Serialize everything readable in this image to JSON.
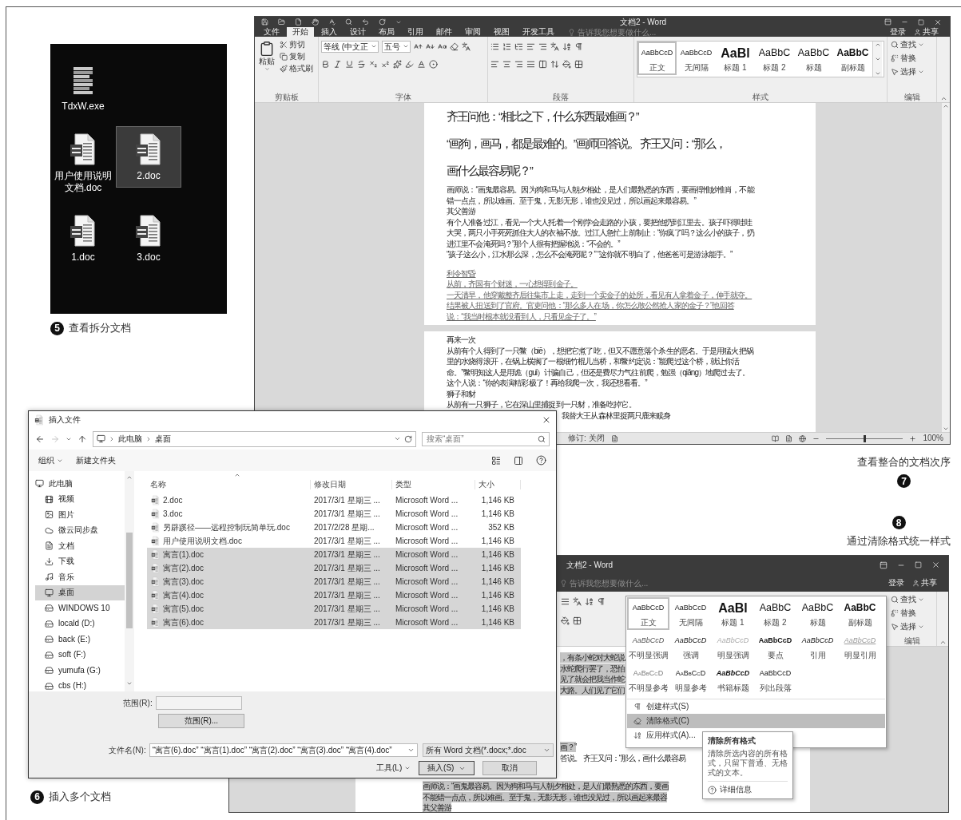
{
  "desktop": {
    "icons": [
      {
        "label": "TdxW.exe",
        "kind": "exe",
        "selected": false
      },
      {
        "label": "用户使用说明文档.doc",
        "kind": "doc",
        "selected": false
      },
      {
        "label": "2.doc",
        "kind": "doc",
        "selected": true
      },
      {
        "label": "1.doc",
        "kind": "doc",
        "selected": false
      },
      {
        "label": "3.doc",
        "kind": "doc",
        "selected": false
      }
    ]
  },
  "caption_5": {
    "number": "5",
    "text": "查看拆分文档"
  },
  "word_window": {
    "title": "文档2 - Word",
    "tabs": [
      {
        "label": "文件",
        "selected": false
      },
      {
        "label": "开始",
        "selected": true
      },
      {
        "label": "插入",
        "selected": false
      },
      {
        "label": "设计",
        "selected": false
      },
      {
        "label": "布局",
        "selected": false
      },
      {
        "label": "引用",
        "selected": false
      },
      {
        "label": "邮件",
        "selected": false
      },
      {
        "label": "审阅",
        "selected": false
      },
      {
        "label": "视图",
        "selected": false
      },
      {
        "label": "开发工具",
        "selected": false
      }
    ],
    "tell_me": {
      "placeholder": "告诉我您想要做什么..."
    },
    "sign_in": "登录",
    "share": "共享",
    "clipboard": {
      "label": "剪贴板",
      "paste": "粘贴",
      "cut": "剪切",
      "copy": "复制",
      "format_painter": "格式刷"
    },
    "font": {
      "label": "字体",
      "font_name": "等线 (中文正",
      "font_size": "五号"
    },
    "paragraph": {
      "label": "段落"
    },
    "styles": {
      "label": "样式",
      "items": [
        {
          "preview": "AaBbCcD",
          "name": "正文",
          "kind": "normal",
          "selected": true
        },
        {
          "preview": "AaBbCcD",
          "name": "无间隔",
          "kind": "nospacing",
          "selected": false
        },
        {
          "preview": "AaBl",
          "name": "标题 1",
          "kind": "heading1",
          "selected": false
        },
        {
          "preview": "AaBbC",
          "name": "标题 2",
          "kind": "heading2",
          "selected": false
        },
        {
          "preview": "AaBbC",
          "name": "标题",
          "kind": "title",
          "selected": false
        },
        {
          "preview": "AaBbC",
          "name": "副标题",
          "kind": "subtitle",
          "selected": false
        }
      ]
    },
    "editing": {
      "label": "编辑",
      "find": "查找",
      "replace": "替换",
      "select": "选择"
    },
    "page_1": [
      {
        "kind": "heading",
        "text": "齐王问他：“相比之下，什么东西最难画？”"
      },
      {
        "kind": "heading",
        "text": "“画狗，画马，都是最难的。”画师回答说。 齐王又问：“那么，"
      },
      {
        "kind": "heading",
        "text": "画什么最容易呢？”"
      },
      {
        "kind": "body",
        "text": "画师说：“画鬼最容易。因为狗和马与人朝夕相处，是人们最熟悉的东西，要画得惟妙惟肖，不能错一点点，所以难画。至于鬼，无影无形，谁也没见过，所以画起来最容易。”"
      },
      {
        "kind": "body",
        "text": "其父善游"
      },
      {
        "kind": "body",
        "text": "有个人准备过江，看见一个大人托着一个刚学会走路的小孩，要把他扔到江里去。孩子吓得哇哇大哭，两只小手死死抓住大人的衣袖不放。过江人急忙上前制止：“你疯了吗？这么小的孩子，扔进江里不会淹死吗？”那个人很有把握地说：“不会的。”"
      },
      {
        "kind": "body",
        "text": "“孩子这么小，江水那么深，怎么不会淹死呢？” “这你就不明白了，他爸爸可是游泳能手。”"
      },
      {
        "kind": "revised",
        "text": "利令智昏"
      },
      {
        "kind": "revised",
        "text": "从前，齐国有个财迷，一心想得到金子。"
      },
      {
        "kind": "revised",
        "text": "一天清早，他穿戴整齐后往集市上走，走到一个卖金子的处所，看见有人拿着金子，伸手就夺。结果被人扭送到了官府。官吏问他：“那么多人在场，你怎么敢公然抢人家的金子？”他回答说：“我当时根本就没看到人，只看见金子了。”"
      }
    ],
    "page_2": [
      {
        "kind": "body",
        "text": "再来一次"
      },
      {
        "kind": "body",
        "text": "从前有个人得到了一只鳖（biē），想把它煮了吃，但又不愿意落个杀生的恶名。于是用猛火把锅里的水烧得滚开，在锅上横搁了一根细竹棍儿当桥，和鳖约定说：“能爬过这个桥，就让你活命。”鳖明知这人是用诡（guǐ）计骗自己，但还是费尽力气往前爬，勉强（qiǎng）地爬过去了。这个人说：“你的表演精彩极了！再给我爬一次，我还想看看。”"
      },
      {
        "kind": "body",
        "text": "狮子和豺"
      },
      {
        "kind": "body",
        "text": "从前有一只狮子，它在深山里捕捉到一只豺，准备吃掉它。"
      },
      {
        "kind": "partial",
        "text": "我替大王从森林里捉两只鹿来赎身"
      }
    ],
    "status_bar": {
      "track_changes": "修订: 关闭",
      "zoom": {
        "level": 0.5,
        "reading": "100%"
      }
    }
  },
  "caption_7": {
    "number": "7",
    "text": "查看整合的文档次序"
  },
  "caption_8": {
    "number": "8",
    "text": "通过清除格式统一样式"
  },
  "word_window_2": {
    "title": "文档2 - Word",
    "tell_me": {
      "placeholder": "告诉我您想要做什么..."
    },
    "sign_in": "登录",
    "share": "共享",
    "editing": {
      "label": "编辑",
      "find": "查找",
      "replace": "替换",
      "select": "选择"
    },
    "style_gallery": {
      "items": [
        {
          "preview": "AaBbCcD",
          "name": "正文",
          "kind": "normal",
          "selected": true
        },
        {
          "preview": "AaBbCcD",
          "name": "无间隔",
          "kind": "nospacing",
          "selected": false
        },
        {
          "preview": "AaBl",
          "name": "标题 1",
          "kind": "heading1",
          "selected": false
        },
        {
          "preview": "AaBbC",
          "name": "标题 2",
          "kind": "heading2",
          "selected": false
        },
        {
          "preview": "AaBbC",
          "name": "标题",
          "kind": "title",
          "selected": false
        },
        {
          "preview": "AaBbC",
          "name": "副标题",
          "kind": "subtitle",
          "selected": false
        },
        {
          "preview": "AaBbCcD",
          "name": "不明显强调",
          "kind": "subtle",
          "selected": false
        },
        {
          "preview": "AaBbCcD",
          "name": "强调",
          "kind": "emphasis",
          "selected": false
        },
        {
          "preview": "AaBbCcD",
          "name": "明显强调",
          "kind": "intense",
          "selected": false
        },
        {
          "preview": "AaBbCcD",
          "name": "要点",
          "kind": "strong",
          "selected": false
        },
        {
          "preview": "AaBbCcD",
          "name": "引用",
          "kind": "quote",
          "selected": false
        },
        {
          "preview": "AaBbCcD",
          "name": "明显引用",
          "kind": "intensequote",
          "selected": false
        },
        {
          "preview": "AaBbCcD",
          "name": "不明显参考",
          "kind": "subtleref",
          "selected": false
        },
        {
          "preview": "AaBbCcD",
          "name": "明显参考",
          "kind": "intenseref",
          "selected": false
        },
        {
          "preview": "AaBbCcD",
          "name": "书籍标题",
          "kind": "booktitle",
          "selected": false
        },
        {
          "preview": "AaBbCcD",
          "name": "列出段落",
          "kind": "list",
          "selected": false
        }
      ],
      "commands": [
        {
          "label": "创建样式(S)",
          "kind": "create",
          "selected": false
        },
        {
          "label": "清除格式(C)",
          "kind": "clear",
          "selected": true
        },
        {
          "label": "应用样式(A)...",
          "kind": "apply",
          "selected": false
        }
      ]
    },
    "tooltip": {
      "title": "清除所有格式",
      "body": "清除所选内容的所有格式，只留下普通、无格式的文本。",
      "link": "详细信息"
    },
    "document": [
      {
        "lines": [
          {
            "kind": "partial",
            "text": "，有条小蛇对大蛇说",
            "selected": true
          },
          {
            "kind": "partial",
            "text": "水蛇爬行罢了，恐怕",
            "selected": true
          },
          {
            "kind": "partial",
            "text": "见了就会把我当作蛇",
            "selected": true
          },
          {
            "kind": "partial",
            "text": "大路。人们见了它们",
            "selected": true
          }
        ]
      },
      {
        "lines": [
          {
            "kind": "partial",
            "text": "画？”",
            "selected": true
          },
          {
            "kind": "partial",
            "text": "答说。 齐王又问：“那么，画什么最容易",
            "selected": false
          }
        ]
      },
      {
        "lines": [
          {
            "kind": "full",
            "text": "画师说：“画鬼最容易。因为狗和马与人朝夕相处，是人们最熟悉的东西，要画",
            "selected": true
          },
          {
            "kind": "full",
            "text": "不能错一点点，所以难画。至于鬼，无影无形，谁也没见过，所以画起来最容",
            "selected": true
          },
          {
            "kind": "full",
            "text": "其父善游",
            "selected": true
          }
        ]
      }
    ]
  },
  "dialog": {
    "title": "插入文件",
    "path": [
      "此电脑",
      "桌面"
    ],
    "search": {
      "placeholder": "搜索“桌面”"
    },
    "organize": "组织",
    "new_folder": "新建文件夹",
    "nav": [
      {
        "label": "此电脑",
        "kind": "pc",
        "selected": false
      },
      {
        "label": "视频",
        "kind": "videos",
        "selected": false
      },
      {
        "label": "图片",
        "kind": "pictures",
        "selected": false
      },
      {
        "label": "微云同步盘",
        "kind": "cloud",
        "selected": false
      },
      {
        "label": "文档",
        "kind": "documents",
        "selected": false
      },
      {
        "label": "下载",
        "kind": "downloads",
        "selected": false
      },
      {
        "label": "音乐",
        "kind": "music",
        "selected": false
      },
      {
        "label": "桌面",
        "kind": "desktop",
        "selected": true
      },
      {
        "label": "WINDOWS 10",
        "kind": "system",
        "selected": false
      },
      {
        "label": "locald (D:)",
        "kind": "drive",
        "selected": false
      },
      {
        "label": "back (E:)",
        "kind": "drive",
        "selected": false
      },
      {
        "label": "soft (F:)",
        "kind": "drive",
        "selected": false
      },
      {
        "label": "yumufa (G:)",
        "kind": "drive",
        "selected": false
      },
      {
        "label": "cbs (H:)",
        "kind": "drive",
        "selected": false
      }
    ],
    "columns": [
      "名称",
      "修改日期",
      "类型",
      "大小"
    ],
    "files": [
      {
        "name": "2.doc",
        "date": "2017/3/1 星期三 ...",
        "type": "Microsoft Word ...",
        "size": "1,146 KB",
        "selected": false
      },
      {
        "name": "3.doc",
        "date": "2017/3/1 星期三 ...",
        "type": "Microsoft Word ...",
        "size": "1,146 KB",
        "selected": false
      },
      {
        "name": "另辟蹊径——远程控制玩简单玩.doc",
        "date": "2017/2/28 星期...",
        "type": "Microsoft Word ...",
        "size": "352 KB",
        "selected": false
      },
      {
        "name": "用户使用说明文档.doc",
        "date": "2017/3/1 星期三 ...",
        "type": "Microsoft Word ...",
        "size": "1,146 KB",
        "selected": false
      },
      {
        "name": "寓言(1).doc",
        "date": "2017/3/1 星期三 ...",
        "type": "Microsoft Word ...",
        "size": "1,146 KB",
        "selected": true
      },
      {
        "name": "寓言(2).doc",
        "date": "2017/3/1 星期三 ...",
        "type": "Microsoft Word ...",
        "size": "1,146 KB",
        "selected": true
      },
      {
        "name": "寓言(3).doc",
        "date": "2017/3/1 星期三 ...",
        "type": "Microsoft Word ...",
        "size": "1,146 KB",
        "selected": true
      },
      {
        "name": "寓言(4).doc",
        "date": "2017/3/1 星期三 ...",
        "type": "Microsoft Word ...",
        "size": "1,146 KB",
        "selected": true
      },
      {
        "name": "寓言(5).doc",
        "date": "2017/3/1 星期三 ...",
        "type": "Microsoft Word ...",
        "size": "1,146 KB",
        "selected": true
      },
      {
        "name": "寓言(6).doc",
        "date": "2017/3/1 星期三 ...",
        "type": "Microsoft Word ...",
        "size": "1,146 KB",
        "selected": true
      }
    ],
    "range_label": "范围(R):",
    "range_button": "范围(R)...",
    "file_name_label": "文件名(N):",
    "file_name": "“寓言(6).doc” “寓言(1).doc” “寓言(2).doc” “寓言(3).doc” “寓言(4).doc”",
    "file_type": "所有 Word 文档(*.docx;*.doc",
    "tools": "工具(L)",
    "insert": "插入(S)",
    "cancel": "取消"
  },
  "caption_6": {
    "number": "6",
    "text": "插入多个文档"
  }
}
